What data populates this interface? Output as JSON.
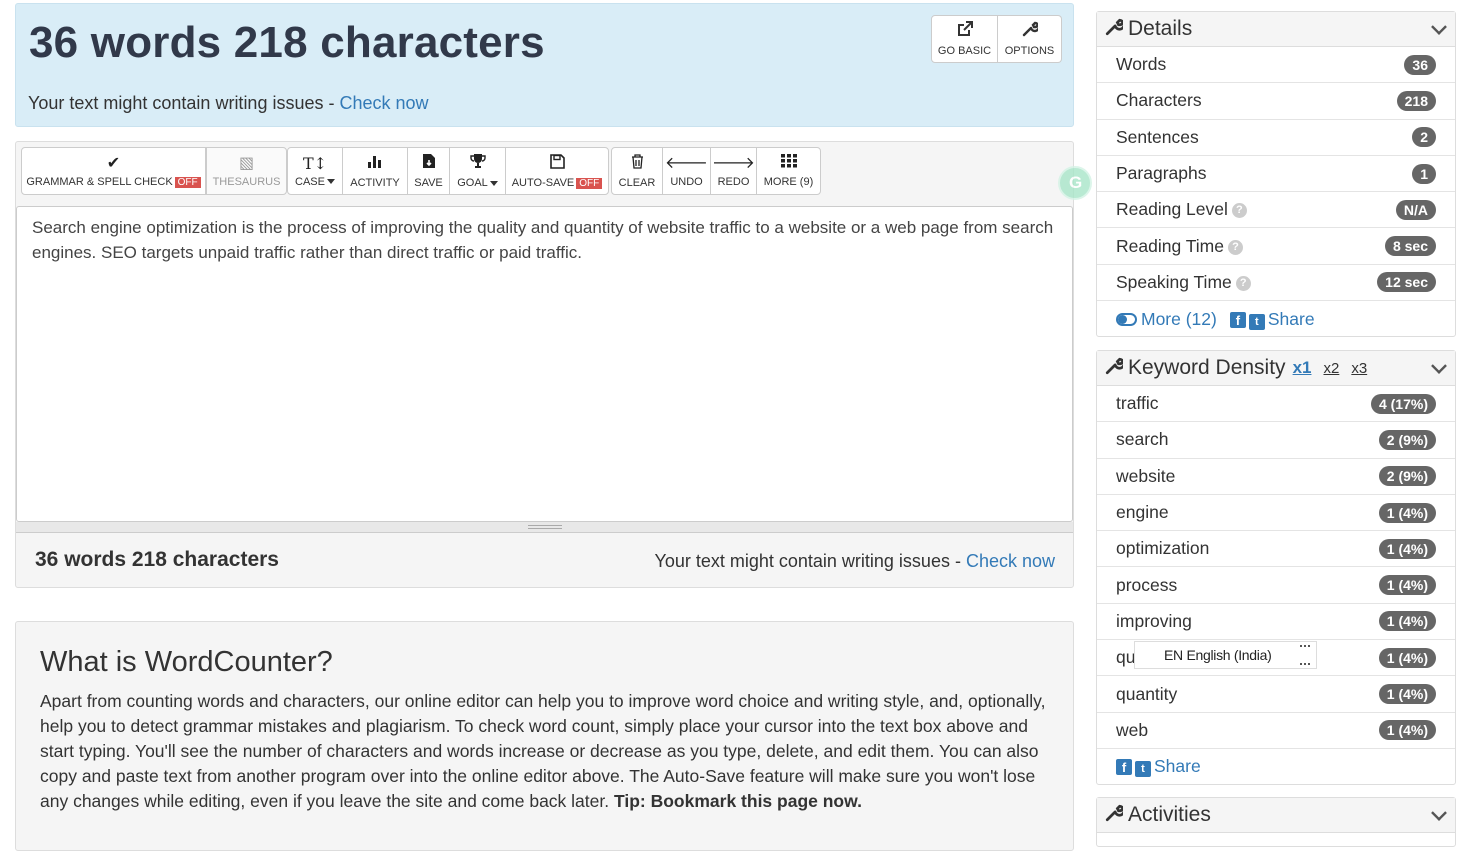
{
  "header": {
    "title": "36 words 218 characters",
    "issues_text": "Your text might contain writing issues - ",
    "check_now": "Check now",
    "go_basic": "GO BASIC",
    "options": "OPTIONS"
  },
  "toolbar": {
    "grammar": "GRAMMAR & SPELL CHECK",
    "grammar_state": "OFF",
    "thesaurus": "THESAURUS",
    "case": "CASE",
    "activity": "ACTIVITY",
    "save": "SAVE",
    "goal": "GOAL",
    "autosave": "AUTO-SAVE",
    "autosave_state": "OFF",
    "clear": "CLEAR",
    "undo": "UNDO",
    "redo": "REDO",
    "more": "MORE (9)"
  },
  "editor": {
    "text": "Search engine optimization is the process of improving the quality and quantity of website traffic to a website or a web page from search engines. SEO targets unpaid traffic rather than direct traffic or paid traffic."
  },
  "footer": {
    "count": "36 words 218 characters",
    "issues_text": "Your text might contain writing issues - ",
    "check_now": "Check now"
  },
  "about": {
    "heading": "What is WordCounter?",
    "body": "Apart from counting words and characters, our online editor can help you to improve word choice and writing style, and, optionally, help you to detect grammar mistakes and plagiarism. To check word count, simply place your cursor into the text box above and start typing. You'll see the number of characters and words increase or decrease as you type, delete, and edit them. You can also copy and paste text from another program over into the online editor above. The Auto-Save feature will make sure you won't lose any changes while editing, even if you leave the site and come back later.",
    "tip": "Tip: Bookmark this page now."
  },
  "details": {
    "title": "Details",
    "rows": [
      {
        "label": "Words",
        "value": "36"
      },
      {
        "label": "Characters",
        "value": "218"
      },
      {
        "label": "Sentences",
        "value": "2"
      },
      {
        "label": "Paragraphs",
        "value": "1"
      },
      {
        "label": "Reading Level",
        "value": "N/A"
      },
      {
        "label": "Reading Time",
        "value": "8 sec"
      },
      {
        "label": "Speaking Time",
        "value": "12 sec"
      }
    ],
    "more": "More (12)",
    "share": "Share"
  },
  "keyword_density": {
    "title": "Keyword Density",
    "tabs": [
      "x1",
      "x2",
      "x3"
    ],
    "rows": [
      {
        "label": "traffic",
        "value": "4 (17%)"
      },
      {
        "label": "search",
        "value": "2 (9%)"
      },
      {
        "label": "website",
        "value": "2 (9%)"
      },
      {
        "label": "engine",
        "value": "1 (4%)"
      },
      {
        "label": "optimization",
        "value": "1 (4%)"
      },
      {
        "label": "process",
        "value": "1 (4%)"
      },
      {
        "label": "improving",
        "value": "1 (4%)"
      },
      {
        "label": "qu",
        "value": "1 (4%)"
      },
      {
        "label": "quantity",
        "value": "1 (4%)"
      },
      {
        "label": "web",
        "value": "1 (4%)"
      }
    ],
    "share": "Share"
  },
  "language_popup": "EN English (India)",
  "activities": {
    "title": "Activities"
  }
}
